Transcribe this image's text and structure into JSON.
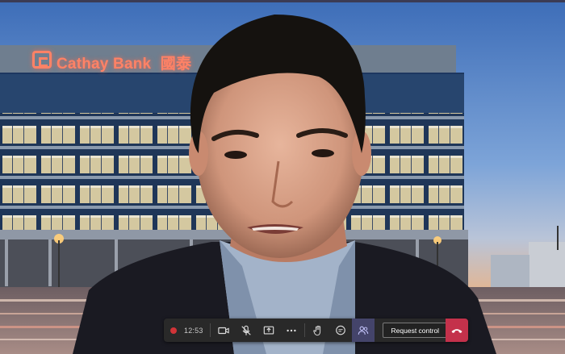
{
  "background": {
    "sign": {
      "brand": "Cathay Bank",
      "chinese": "國泰"
    }
  },
  "toolbar": {
    "timer": "12:53",
    "icons": [
      "record-dot",
      "video-icon",
      "mic-off-icon",
      "share-screen-icon",
      "more-icon",
      "raise-hand-icon",
      "chat-icon",
      "participants-icon",
      "hangup-icon"
    ],
    "request_control_label": "Request control"
  },
  "colors": {
    "toolbar_bg": "#292929",
    "record": "#d13438",
    "hangup": "#c4314b",
    "active": "#44446a",
    "sign": "#ff8266"
  }
}
